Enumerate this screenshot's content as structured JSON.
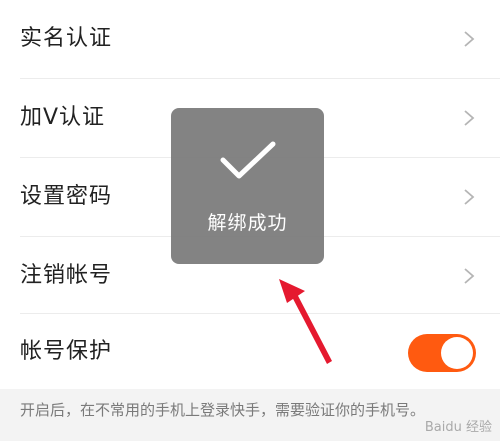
{
  "settings": {
    "items": [
      {
        "label": "实名认证",
        "icon": "chevron-right-icon"
      },
      {
        "label": "加V认证",
        "icon": "chevron-right-icon"
      },
      {
        "label": "设置密码",
        "icon": "chevron-right-icon"
      },
      {
        "label": "注销帐号",
        "icon": "chevron-right-icon"
      }
    ],
    "protection": {
      "label": "帐号保护",
      "enabled": true
    }
  },
  "footer": {
    "note": "开启后，在不常用的手机上登录快手，需要验证你的手机号。"
  },
  "toast": {
    "message": "解绑成功",
    "icon": "checkmark-icon"
  },
  "watermark": "Baidu 经验",
  "colors": {
    "accent": "#ff5a10",
    "toast_bg": "#787878",
    "arrow": "#e5192f"
  }
}
